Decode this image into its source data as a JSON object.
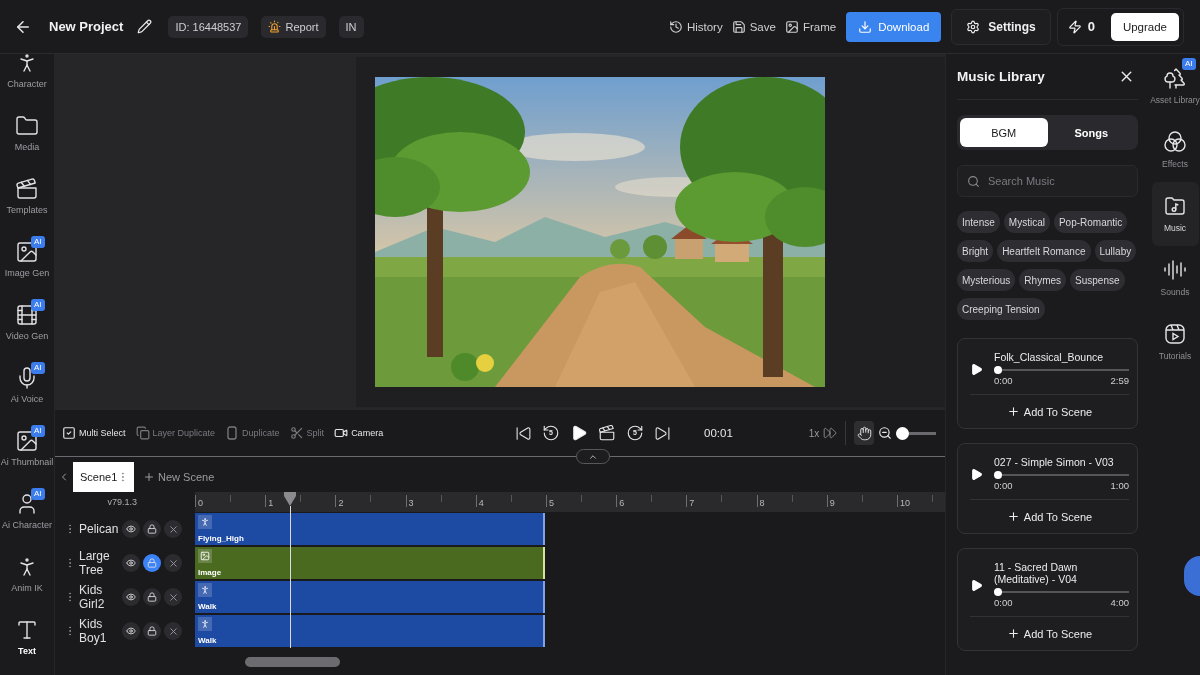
{
  "top_bar": {
    "title": "New Project",
    "project_id": "ID: 16448537",
    "report": "Report",
    "language": "IN",
    "actions": [
      "History",
      "Save",
      "Frame"
    ],
    "download": "Download",
    "settings": "Settings",
    "credits": "0",
    "upgrade": "Upgrade"
  },
  "left_sidebar": {
    "items": [
      {
        "label": "Character",
        "selected": false
      },
      {
        "label": "Media",
        "selected": false
      },
      {
        "label": "Templates",
        "selected": false
      },
      {
        "label": "Image Gen",
        "badge": "AI",
        "selected": false
      },
      {
        "label": "Video Gen",
        "badge": "AI",
        "selected": false
      },
      {
        "label": "Ai Voice",
        "badge": "AI",
        "selected": false
      },
      {
        "label": "Ai Thumbnail",
        "badge": "AI",
        "selected": false
      },
      {
        "label": "Ai Character",
        "badge": "AI",
        "selected": false
      },
      {
        "label": "Anim IK",
        "selected": false
      },
      {
        "label": "Text",
        "selected": true
      }
    ]
  },
  "edit_tools": [
    {
      "label": "Multi Select",
      "disabled": false
    },
    {
      "label": "Layer Duplicate",
      "disabled": true
    },
    {
      "label": "Duplicate",
      "disabled": true
    },
    {
      "label": "Split",
      "disabled": true
    },
    {
      "label": "Camera",
      "disabled": false
    }
  ],
  "playback": {
    "rewind_label": "5",
    "forward_label": "5",
    "time": "00:01",
    "speed": "1x",
    "pan_tool": {
      "selected": true
    },
    "zoom": {
      "level": 0
    }
  },
  "timeline_panel": {
    "expanded": true
  },
  "scenes": {
    "tabs": [
      {
        "label": "Scene1",
        "selected": true
      }
    ],
    "new_scene": "New Scene"
  },
  "timeline": {
    "version": "v79.1.3",
    "ruler": [
      "0",
      "1",
      "2",
      "3",
      "4",
      "5",
      "6",
      "7",
      "8",
      "9",
      "10"
    ],
    "playhead": {
      "level": 0.127
    },
    "layers": [
      {
        "name": "Pelican",
        "locked": false,
        "clip": {
          "kind": "animation",
          "label": "Flying_High"
        }
      },
      {
        "name": "Large Tree",
        "locked": true,
        "clip": {
          "kind": "image",
          "label": "Image"
        }
      },
      {
        "name": "Kids Girl2",
        "locked": false,
        "clip": {
          "kind": "animation",
          "label": "Walk"
        }
      },
      {
        "name": "Kids Boy1",
        "locked": false,
        "clip": {
          "kind": "animation",
          "label": "Walk"
        }
      }
    ]
  },
  "music_library": {
    "title": "Music Library",
    "tabs": [
      {
        "label": "BGM",
        "selected": true
      },
      {
        "label": "Songs",
        "selected": false
      }
    ],
    "search": {
      "placeholder": "Search Music"
    },
    "tags": [
      "Intense",
      "Mystical",
      "Pop-Romantic",
      "Bright",
      "Heartfelt Romance",
      "Lullaby",
      "Mysterious",
      "Rhymes",
      "Suspense",
      "Creeping Tension"
    ],
    "tracks": [
      {
        "title": "Folk_Classical_Bounce",
        "level": 0,
        "elapsed": "0:00",
        "duration": "2:59",
        "action": "Add To Scene"
      },
      {
        "title": "027 - Simple Simon - V03",
        "level": 0,
        "elapsed": "0:00",
        "duration": "1:00",
        "action": "Add To Scene"
      },
      {
        "title": "11 - Sacred Dawn (Meditative) - V04",
        "level": 0,
        "elapsed": "0:00",
        "duration": "4:00",
        "action": "Add To Scene"
      }
    ]
  },
  "right_rail": {
    "items": [
      {
        "label": "Asset Library",
        "badge": "AI",
        "selected": false
      },
      {
        "label": "Effects",
        "selected": false
      },
      {
        "label": "Music",
        "selected": true
      },
      {
        "label": "Sounds",
        "selected": false
      },
      {
        "label": "Tutorials",
        "selected": false
      }
    ]
  }
}
